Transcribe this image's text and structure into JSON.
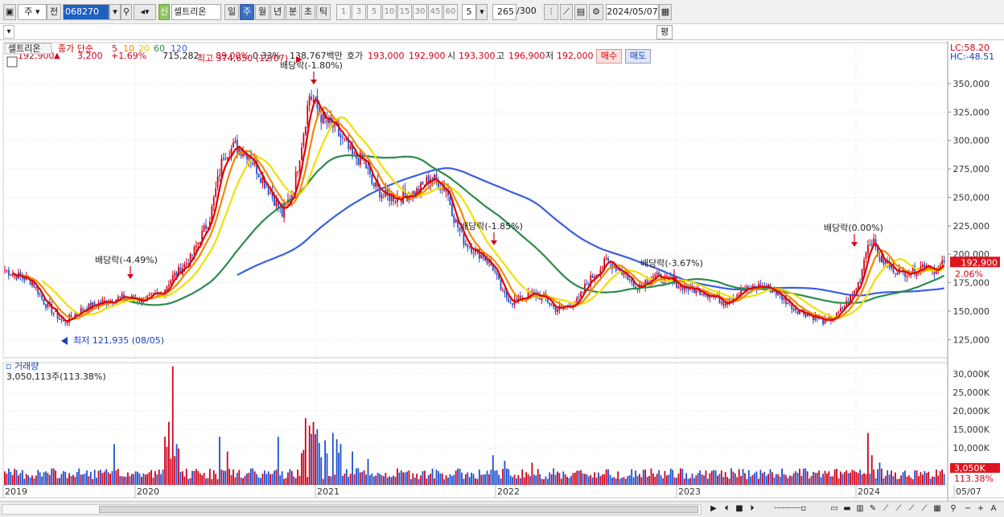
{
  "toolbar": {
    "market_label": "주",
    "prev_label": "전",
    "code": "068270",
    "stock_name": "셀트리온",
    "badge_new": "신",
    "periods": [
      "일",
      "주",
      "월",
      "년",
      "분",
      "초",
      "틱"
    ],
    "period_selected": "주",
    "intervals": [
      "1",
      "3",
      "5",
      "10",
      "15",
      "30",
      "45",
      "60"
    ],
    "interval_value": "5",
    "count": "265",
    "count_total": "/300",
    "date": "2024/05/07"
  },
  "quote": {
    "price": "192,900",
    "change": "3,200",
    "change_pct": "+1.69%",
    "volume": "715,282",
    "vol_ratio": "89.00%",
    "turnover": "0.33%",
    "amount": "138,767백만",
    "bid_label": "호가",
    "bid1": "193,000",
    "bid2": "192,900",
    "open_label": "시",
    "open": "193,300",
    "high_label": "고",
    "high": "196,900",
    "low_label": "저",
    "low": "192,000",
    "buy_label": "매수",
    "sell_label": "매도",
    "eval_label": "평"
  },
  "colors": {
    "up": "#d0021b",
    "down": "#1f4fd0",
    "ma5": "#e00000",
    "ma10": "#f08a00",
    "ma20": "#f0e000",
    "ma60": "#2c8a4e",
    "ma120": "#3a5fe0"
  },
  "chart_data": {
    "type": "candlestick",
    "title": "셀트리온",
    "legend": {
      "series_label": "종가 단순",
      "periods": [
        "5",
        "10",
        "20",
        "60",
        "120"
      ]
    },
    "top_right": {
      "lc": "LC:58.20",
      "hc": "HC:-48.51"
    },
    "x_labels": [
      "2019",
      "2020",
      "2021",
      "2022",
      "2023",
      "2024",
      "05/07"
    ],
    "y_labels": [
      "350,000",
      "325,000",
      "300,000",
      "275,000",
      "250,000",
      "225,000",
      "200,000",
      "175,000",
      "150,000",
      "125,000"
    ],
    "ylim": [
      109000,
      386000
    ],
    "last_price_label": "192,900",
    "last_pct_label": "2.06%",
    "annotations": {
      "high": "최고 374,650 (12/07)",
      "low": "최저 121,935 (08/05)",
      "dividends": [
        "배당락(-4.49%)",
        "배당락(-1.80%)",
        "배당락(-1.85%)",
        "배당락(-3.67%)",
        "배당락(0.00%)"
      ]
    },
    "anchors": [
      [
        0,
        186000
      ],
      [
        8,
        180000
      ],
      [
        14,
        176000
      ],
      [
        20,
        158000
      ],
      [
        30,
        140000
      ],
      [
        40,
        152000
      ],
      [
        50,
        158000
      ],
      [
        60,
        162000
      ],
      [
        70,
        160000
      ],
      [
        80,
        165000
      ],
      [
        85,
        178000
      ],
      [
        95,
        196000
      ],
      [
        105,
        232000
      ],
      [
        112,
        288000
      ],
      [
        118,
        295000
      ],
      [
        125,
        288000
      ],
      [
        130,
        272000
      ],
      [
        138,
        248000
      ],
      [
        142,
        235000
      ],
      [
        148,
        258000
      ],
      [
        152,
        298000
      ],
      [
        156,
        340000
      ],
      [
        158,
        335000
      ],
      [
        163,
        318000
      ],
      [
        168,
        312000
      ],
      [
        174,
        298000
      ],
      [
        178,
        286000
      ],
      [
        184,
        282000
      ],
      [
        188,
        262000
      ],
      [
        194,
        252000
      ],
      [
        200,
        250000
      ],
      [
        206,
        252000
      ],
      [
        212,
        256000
      ],
      [
        218,
        268000
      ],
      [
        222,
        262000
      ],
      [
        226,
        258000
      ],
      [
        230,
        232000
      ],
      [
        235,
        212000
      ],
      [
        240,
        204000
      ],
      [
        245,
        198000
      ],
      [
        250,
        188000
      ],
      [
        255,
        165000
      ],
      [
        260,
        158000
      ],
      [
        265,
        162000
      ],
      [
        270,
        165000
      ],
      [
        276,
        162000
      ],
      [
        282,
        152000
      ],
      [
        288,
        154000
      ],
      [
        294,
        160000
      ],
      [
        298,
        175000
      ],
      [
        304,
        186000
      ],
      [
        308,
        194000
      ],
      [
        312,
        190000
      ],
      [
        318,
        182000
      ],
      [
        322,
        172000
      ],
      [
        326,
        174000
      ],
      [
        332,
        181000
      ],
      [
        338,
        178000
      ],
      [
        344,
        174000
      ],
      [
        350,
        170000
      ],
      [
        356,
        168000
      ],
      [
        362,
        164000
      ],
      [
        368,
        158000
      ],
      [
        372,
        162000
      ],
      [
        378,
        168000
      ],
      [
        386,
        172000
      ],
      [
        392,
        170000
      ],
      [
        398,
        162000
      ],
      [
        404,
        153000
      ],
      [
        410,
        148000
      ],
      [
        416,
        144000
      ],
      [
        420,
        140000
      ],
      [
        426,
        146000
      ],
      [
        430,
        155000
      ],
      [
        434,
        164000
      ],
      [
        438,
        178000
      ],
      [
        441,
        205000
      ],
      [
        444,
        214000
      ],
      [
        448,
        196000
      ],
      [
        454,
        188000
      ],
      [
        460,
        184000
      ],
      [
        466,
        186000
      ],
      [
        472,
        192000
      ],
      [
        477,
        185000
      ],
      [
        481,
        192900
      ]
    ],
    "volume_labels": [
      "30,000K",
      "25,000K",
      "20,000K",
      "15,000K",
      "10,000K",
      "5,000K"
    ],
    "volume_title": "거래량",
    "volume_value": "3,050,113주(113.38%)",
    "volume_last_label": "3,050K",
    "volume_last_pct": "113.38%",
    "volume_ylim": [
      0,
      33000
    ]
  },
  "bottom": {
    "icons": [
      "▶",
      "⏮",
      "■",
      "⏭"
    ]
  }
}
